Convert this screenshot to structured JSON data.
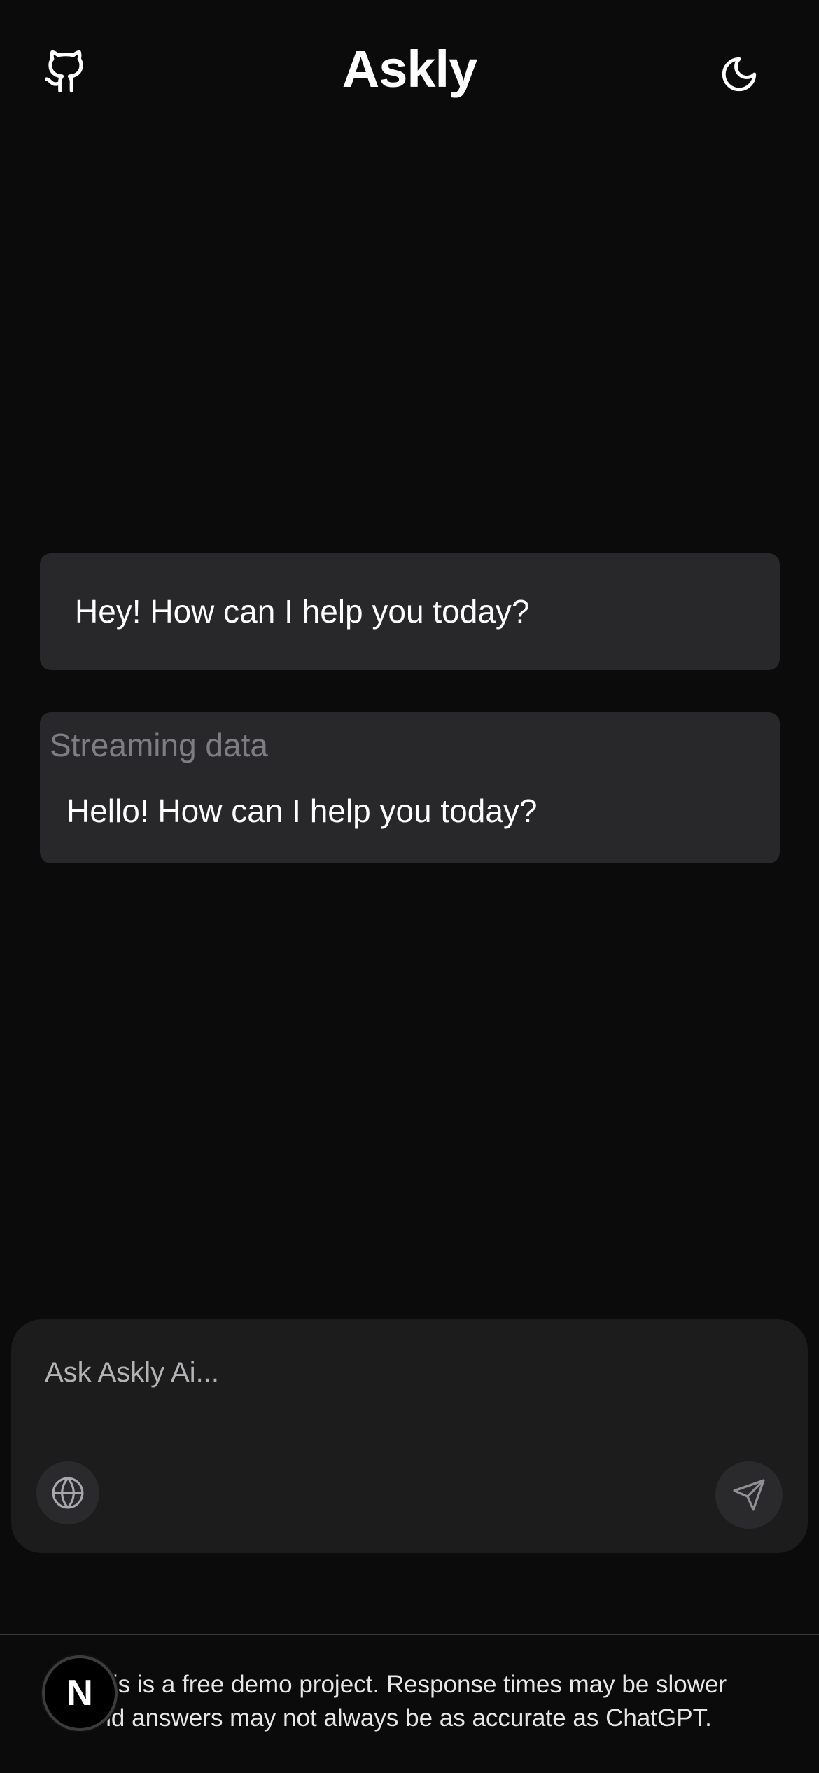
{
  "header": {
    "title": "Askly",
    "github_icon": "github-icon",
    "theme_icon": "moon-icon"
  },
  "messages": [
    {
      "text": "Hey! How can I help you today?"
    },
    {
      "status": "Streaming data",
      "text": "Hello! How can I help you today?"
    }
  ],
  "composer": {
    "placeholder": "Ask Askly Ai...",
    "value": "",
    "globe_icon": "globe-icon",
    "send_icon": "send-icon"
  },
  "footer": {
    "notice_line1": "This is a free demo project. Response times may be slower",
    "notice_line2": "and answers may not always be as accurate as ChatGPT.",
    "badge_label": "N"
  },
  "colors": {
    "background": "#0b0b0b",
    "message_bubble": "#28282b",
    "composer": "#1c1c1d",
    "muted_text": "#7d7d83"
  }
}
